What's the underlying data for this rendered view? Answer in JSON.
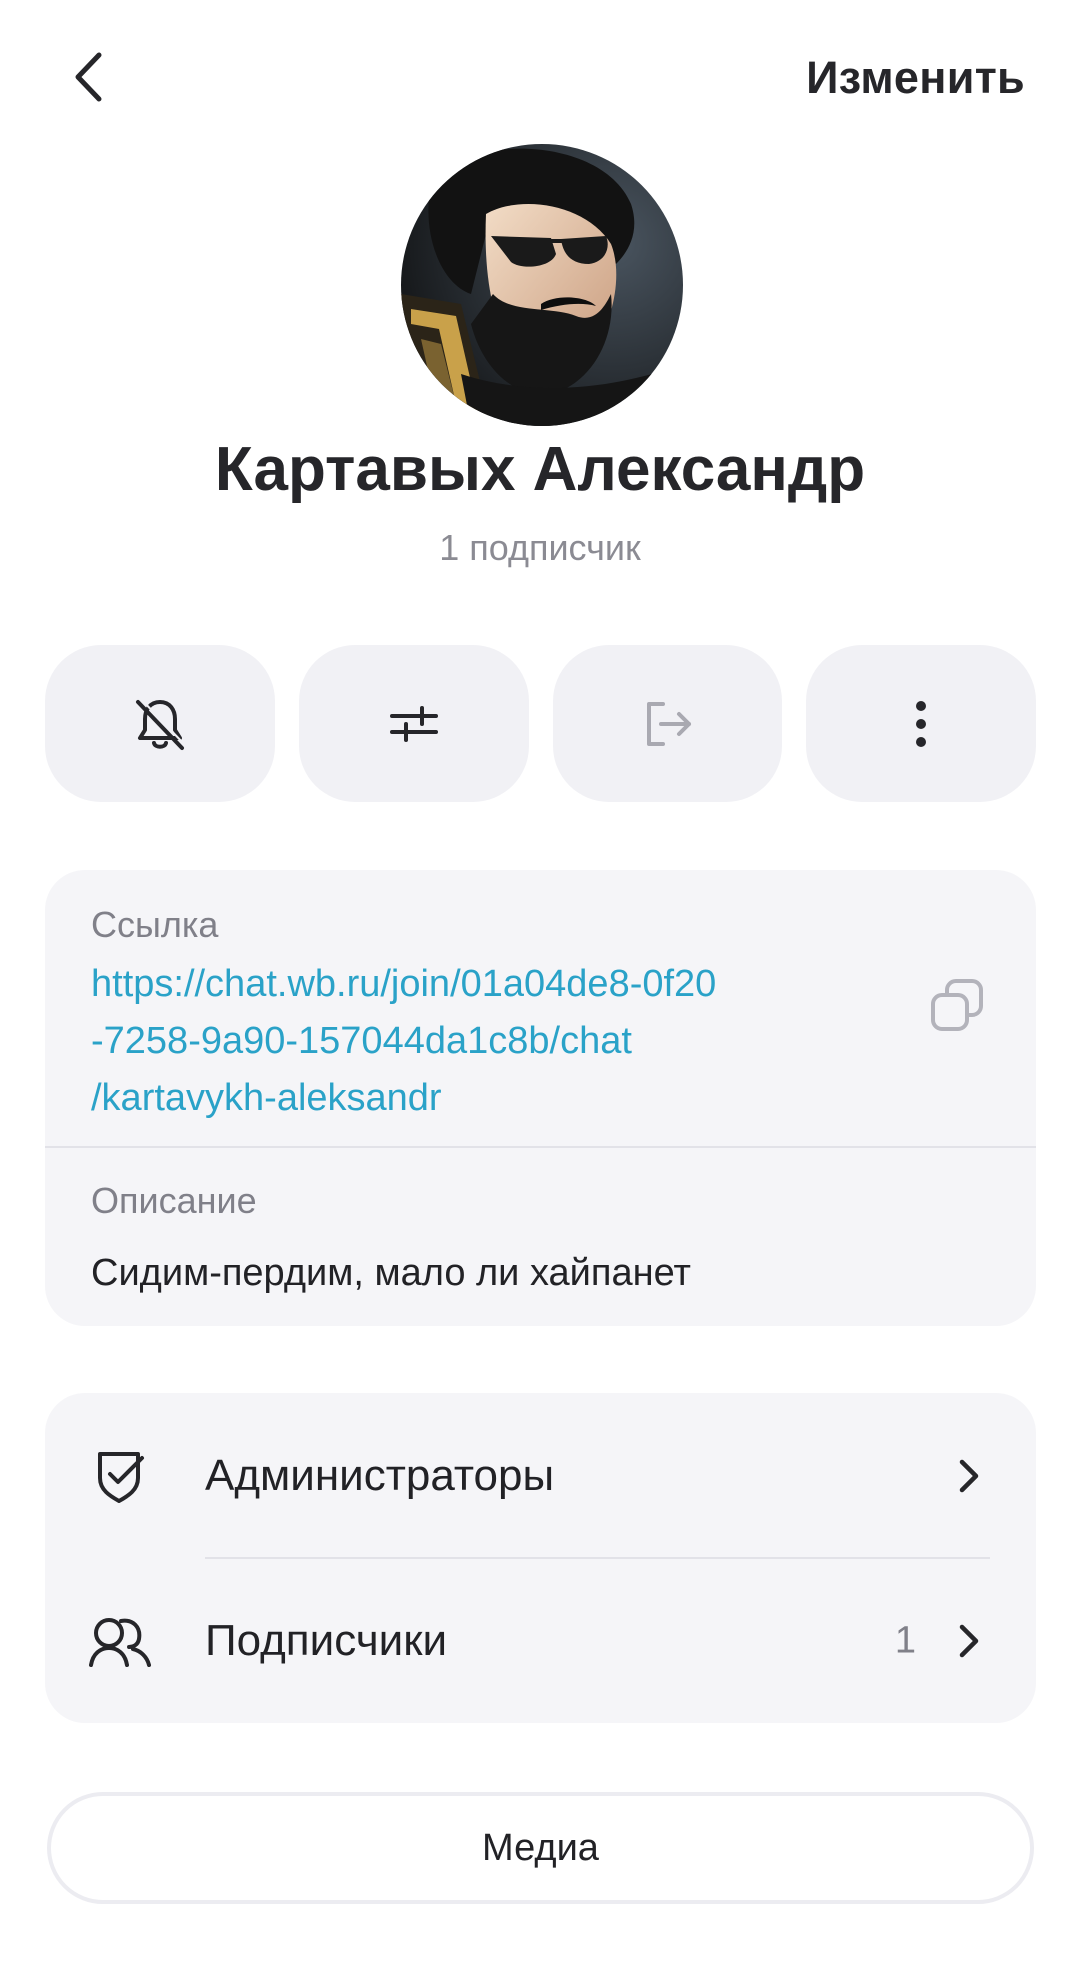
{
  "header": {
    "back_icon": "chevron-left-icon",
    "edit_label": "Изменить"
  },
  "profile": {
    "name": "Картавых Александр",
    "subscribers_text": "1 подписчик"
  },
  "actions": [
    {
      "name": "mute-notifications",
      "icon": "bell-off-icon"
    },
    {
      "name": "settings",
      "icon": "sliders-icon"
    },
    {
      "name": "leave",
      "icon": "exit-icon"
    },
    {
      "name": "more",
      "icon": "more-vertical-icon"
    }
  ],
  "info": {
    "link_label": "Ссылка",
    "link_value": "https://chat.wb.ru/join/01a04de8-0f20-7258-9a90-157044da1c8b/chat/kartavykh-aleksandr",
    "link_lines": [
      "https://chat.wb.ru/join/01a04de8-0f20",
      "-7258-9a90-157044da1c8b/chat",
      "/kartavykh-aleksandr"
    ],
    "description_label": "Описание",
    "description_value": "Сидим-пердим, мало ли хайпанет"
  },
  "menu": {
    "admins_label": "Администраторы",
    "subscribers_label": "Подписчики",
    "subscribers_count": "1"
  },
  "media_label": "Медиа",
  "colors": {
    "accent_link": "#2aa2c8",
    "card_bg": "#f5f5f8",
    "button_bg": "#f1f1f5",
    "text_primary": "#222226",
    "text_secondary": "#808089"
  }
}
